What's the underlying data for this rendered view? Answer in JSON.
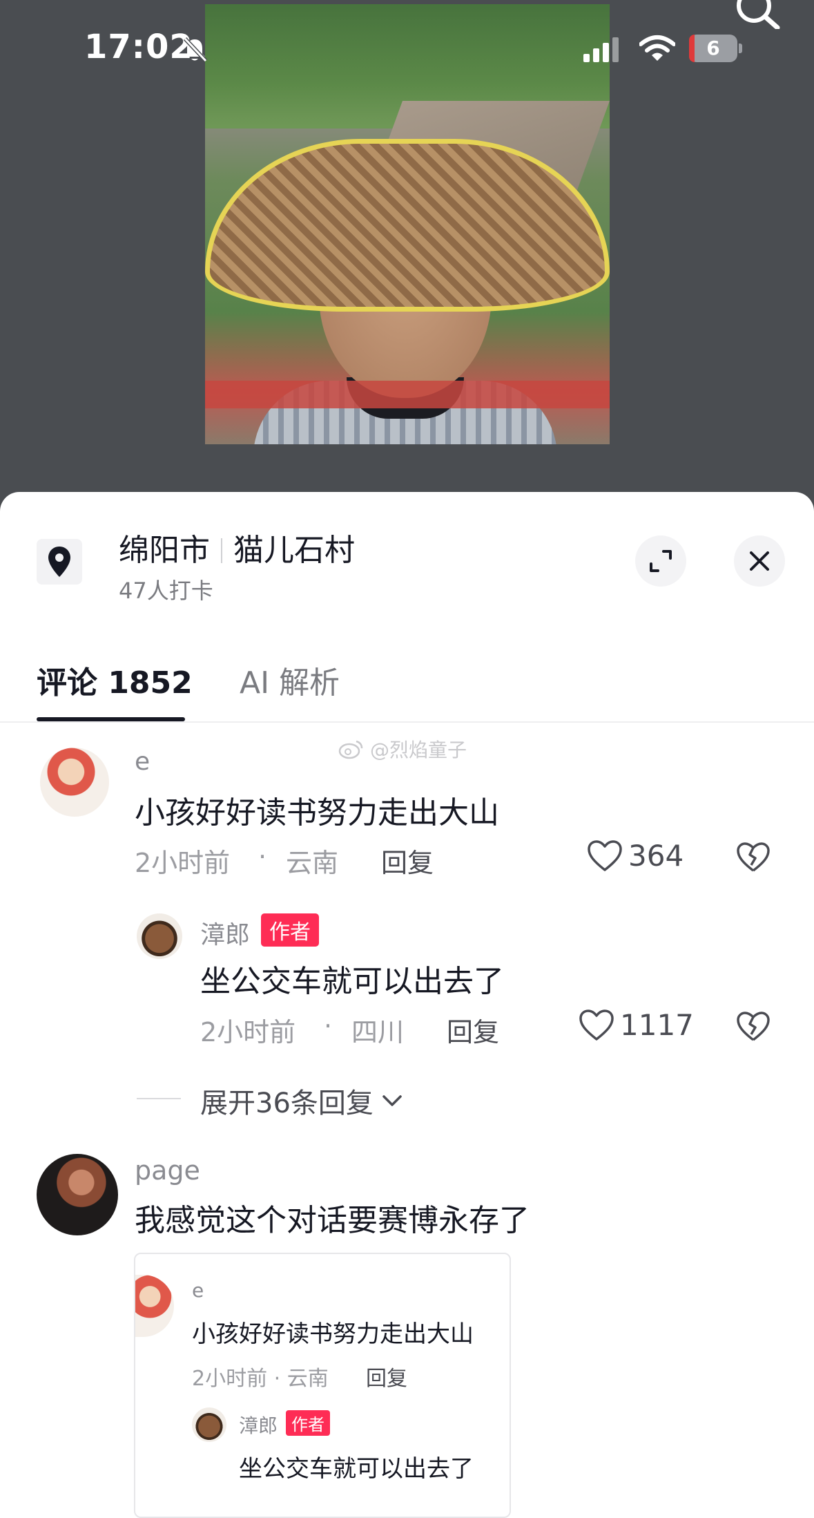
{
  "status_bar": {
    "time": "17:02",
    "battery": "6",
    "icons": [
      "bell-off-icon",
      "signal-icon",
      "wifi-icon",
      "battery-icon",
      "search-icon"
    ]
  },
  "location": {
    "city": "绵阳市",
    "village": "猫儿石村",
    "checkins": "47人打卡",
    "icon": "location-pin-icon"
  },
  "tabs": [
    {
      "label": "评论 1852",
      "active": true
    },
    {
      "label": "AI 解析",
      "active": false
    }
  ],
  "watermark": "@烈焰童子",
  "comments": [
    {
      "username": "e",
      "text": "小孩好好读书努力走出大山",
      "time": "2小时前",
      "region": "云南",
      "reply_label": "回复",
      "likes": "364",
      "replies": [
        {
          "username": "漳郎",
          "tag": "作者",
          "text": "坐公交车就可以出去了",
          "time": "2小时前",
          "region": "四川",
          "reply_label": "回复",
          "likes": "1117"
        }
      ],
      "expand_label": "展开36条回复"
    },
    {
      "username": "page",
      "text": "我感觉这个对话要赛博永存了",
      "quote": {
        "username": "e",
        "text": "小孩好好读书努力走出大山",
        "meta": "2小时前 · 云南",
        "reply_label": "回复",
        "reply": {
          "username": "漳郎",
          "tag": "作者",
          "text": "坐公交车就可以出去了"
        }
      }
    }
  ],
  "colors": {
    "accent": "#fe2c55",
    "text_primary": "#161823",
    "text_secondary": "#7a7b80",
    "overlay_bg": "#4a4d51"
  }
}
